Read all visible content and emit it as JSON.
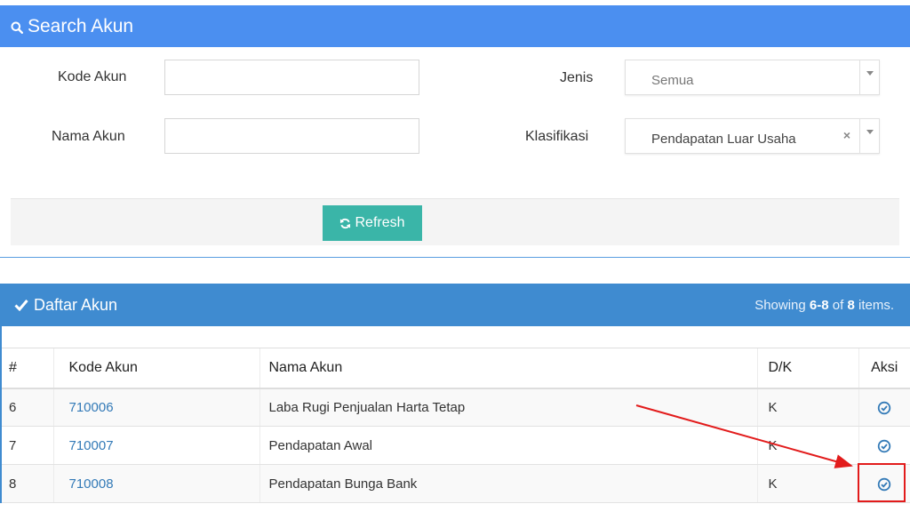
{
  "search": {
    "title": "Search Akun",
    "kode_akun_label": "Kode Akun",
    "kode_akun_value": "",
    "nama_akun_label": "Nama Akun",
    "nama_akun_value": "",
    "jenis_label": "Jenis",
    "jenis_value": "Semua",
    "klasifikasi_label": "Klasifikasi",
    "klasifikasi_value": "Pendapatan Luar Usaha",
    "clear_symbol": "×",
    "refresh_label": "Refresh"
  },
  "list": {
    "title": "Daftar Akun",
    "summary_prefix": "Showing ",
    "summary_range": "6-8",
    "summary_mid": " of ",
    "summary_total": "8",
    "summary_suffix": " items.",
    "columns": [
      "#",
      "Kode Akun",
      "Nama Akun",
      "D/K",
      "Aksi"
    ],
    "rows": [
      {
        "num": "6",
        "kode": "710006",
        "nama": "Laba Rugi Penjualan Harta Tetap",
        "dk": "K"
      },
      {
        "num": "7",
        "kode": "710007",
        "nama": "Pendapatan Awal",
        "dk": "K"
      },
      {
        "num": "8",
        "kode": "710008",
        "nama": "Pendapatan Bunga Bank",
        "dk": "K"
      }
    ]
  },
  "colors": {
    "search_header": "#4b8ff0",
    "list_header": "#3f8bd0",
    "refresh_button": "#3ab5a8",
    "link": "#337ab7",
    "annotation": "#e21b1b"
  }
}
